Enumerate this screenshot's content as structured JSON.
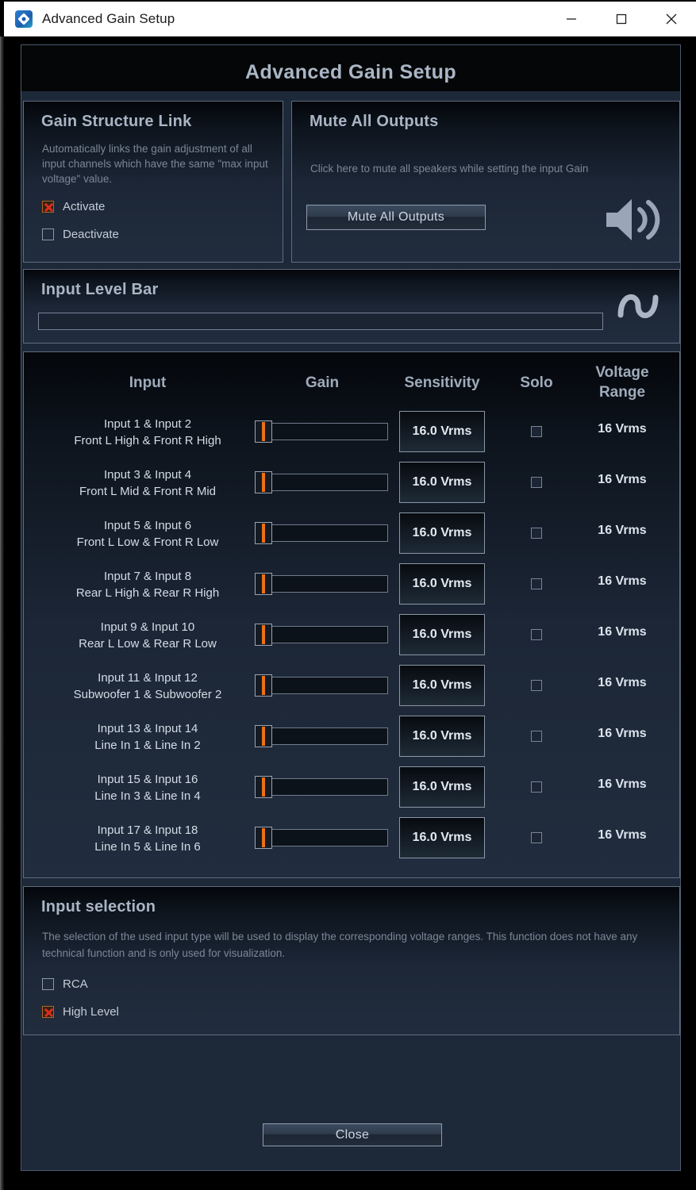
{
  "window": {
    "title": "Advanced Gain Setup",
    "app_icon": "app-logo-icon",
    "minimize_label": "minimize-icon",
    "maximize_label": "maximize-icon",
    "close_label": "close-icon"
  },
  "main_title": "Advanced Gain Setup",
  "gain_structure_link": {
    "title": "Gain Structure Link",
    "description": "Automatically links the gain adjustment of all input channels which have the same \"max input voltage\" value.",
    "options": [
      {
        "label": "Activate",
        "checked": true
      },
      {
        "label": "Deactivate",
        "checked": false
      }
    ]
  },
  "mute_all_outputs": {
    "title": "Mute All Outputs",
    "description": "Click here to mute all speakers while setting the input Gain",
    "button_label": "Mute All Outputs",
    "icon": "speaker-volume-icon"
  },
  "input_level_bar": {
    "title": "Input Level Bar",
    "level_percent": 0,
    "icon": "sine-wave-icon"
  },
  "table": {
    "headers": {
      "input": "Input",
      "gain": "Gain",
      "sensitivity": "Sensitivity",
      "solo": "Solo",
      "voltage_range_line1": "Voltage",
      "voltage_range_line2": "Range"
    },
    "rows": [
      {
        "input_line1": "Input 1 & Input 2",
        "input_line2": "Front L High & Front R High",
        "gain_percent": 0,
        "sensitivity": "16.0 Vrms",
        "solo": false,
        "voltage_range": "16 Vrms"
      },
      {
        "input_line1": "Input 3 & Input 4",
        "input_line2": "Front L Mid & Front R Mid",
        "gain_percent": 0,
        "sensitivity": "16.0 Vrms",
        "solo": false,
        "voltage_range": "16 Vrms"
      },
      {
        "input_line1": "Input 5 & Input 6",
        "input_line2": "Front L Low & Front R Low",
        "gain_percent": 0,
        "sensitivity": "16.0 Vrms",
        "solo": false,
        "voltage_range": "16 Vrms"
      },
      {
        "input_line1": "Input 7 & Input 8",
        "input_line2": "Rear L High & Rear R High",
        "gain_percent": 0,
        "sensitivity": "16.0 Vrms",
        "solo": false,
        "voltage_range": "16 Vrms"
      },
      {
        "input_line1": "Input 9 & Input 10",
        "input_line2": "Rear L Low & Rear R Low",
        "gain_percent": 0,
        "sensitivity": "16.0 Vrms",
        "solo": false,
        "voltage_range": "16 Vrms"
      },
      {
        "input_line1": "Input 11 & Input 12",
        "input_line2": "Subwoofer 1 & Subwoofer 2",
        "gain_percent": 0,
        "sensitivity": "16.0 Vrms",
        "solo": false,
        "voltage_range": "16 Vrms"
      },
      {
        "input_line1": "Input 13 & Input 14",
        "input_line2": "Line In 1 & Line In 2",
        "gain_percent": 0,
        "sensitivity": "16.0 Vrms",
        "solo": false,
        "voltage_range": "16 Vrms"
      },
      {
        "input_line1": "Input 15 & Input 16",
        "input_line2": "Line In 3 & Line In 4",
        "gain_percent": 0,
        "sensitivity": "16.0 Vrms",
        "solo": false,
        "voltage_range": "16 Vrms"
      },
      {
        "input_line1": "Input 17 & Input 18",
        "input_line2": "Line In 5 & Line In 6",
        "gain_percent": 0,
        "sensitivity": "16.0 Vrms",
        "solo": false,
        "voltage_range": "16 Vrms"
      }
    ]
  },
  "input_selection": {
    "title": "Input selection",
    "description": "The selection of the used input type will be used to display the corresponding voltage ranges. This function does not have any technical function and is only used for visualization.",
    "options": [
      {
        "label": "RCA",
        "checked": false
      },
      {
        "label": "High Level",
        "checked": true
      }
    ]
  },
  "footer": {
    "close_label": "Close"
  },
  "colors": {
    "accent_orange": "#ec7014",
    "check_red": "#e02b1a",
    "panel_bg": "#1d2838",
    "text_primary": "#d4dce6",
    "text_muted": "#7b8796",
    "heading": "#a9b5c5",
    "border": "#5d6d80"
  }
}
